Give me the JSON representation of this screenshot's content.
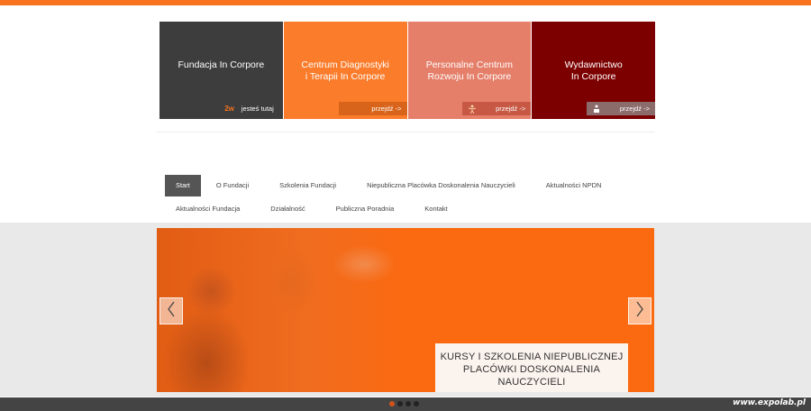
{
  "tiles": [
    {
      "title": "Fundacja In Corpore",
      "footer": "jesteś tutaj",
      "icon": "2w"
    },
    {
      "title": "Centrum Diagnostyki\ni Terapii In Corpore",
      "footer": "przejdź ->",
      "icon": ""
    },
    {
      "title": "Personalne Centrum\nRozwoju In Corpore",
      "footer": "przejdź ->",
      "icon": "person-icon"
    },
    {
      "title": "Wydawnictwo\nIn Corpore",
      "footer": "przejdź ->",
      "icon": "reader-icon"
    }
  ],
  "nav": {
    "row1": [
      "Start",
      "O Fundacji",
      "Szkolenia Fundacji",
      "Niepubliczna Placówka Doskonalenia Nauczycieli",
      "Aktualności NPDN"
    ],
    "row2": [
      "Aktualności Fundacja",
      "Działalność",
      "Publiczna Poradnia",
      "Kontakt"
    ],
    "active": "Start"
  },
  "slider": {
    "caption": "KURSY I SZKOLENIA NIEPUBLICZNEJ PLACÓWKI DOSKONALENIA NAUCZYCIELI",
    "slide_count": 4,
    "active_slide": 1
  },
  "watermark": "www.expolab.pl",
  "colors": {
    "accent": "#f7731d",
    "tile1": "#3d3d3d",
    "tile2": "#fb7d2c",
    "tile3": "#e57f6a",
    "tile4": "#7d0000"
  }
}
